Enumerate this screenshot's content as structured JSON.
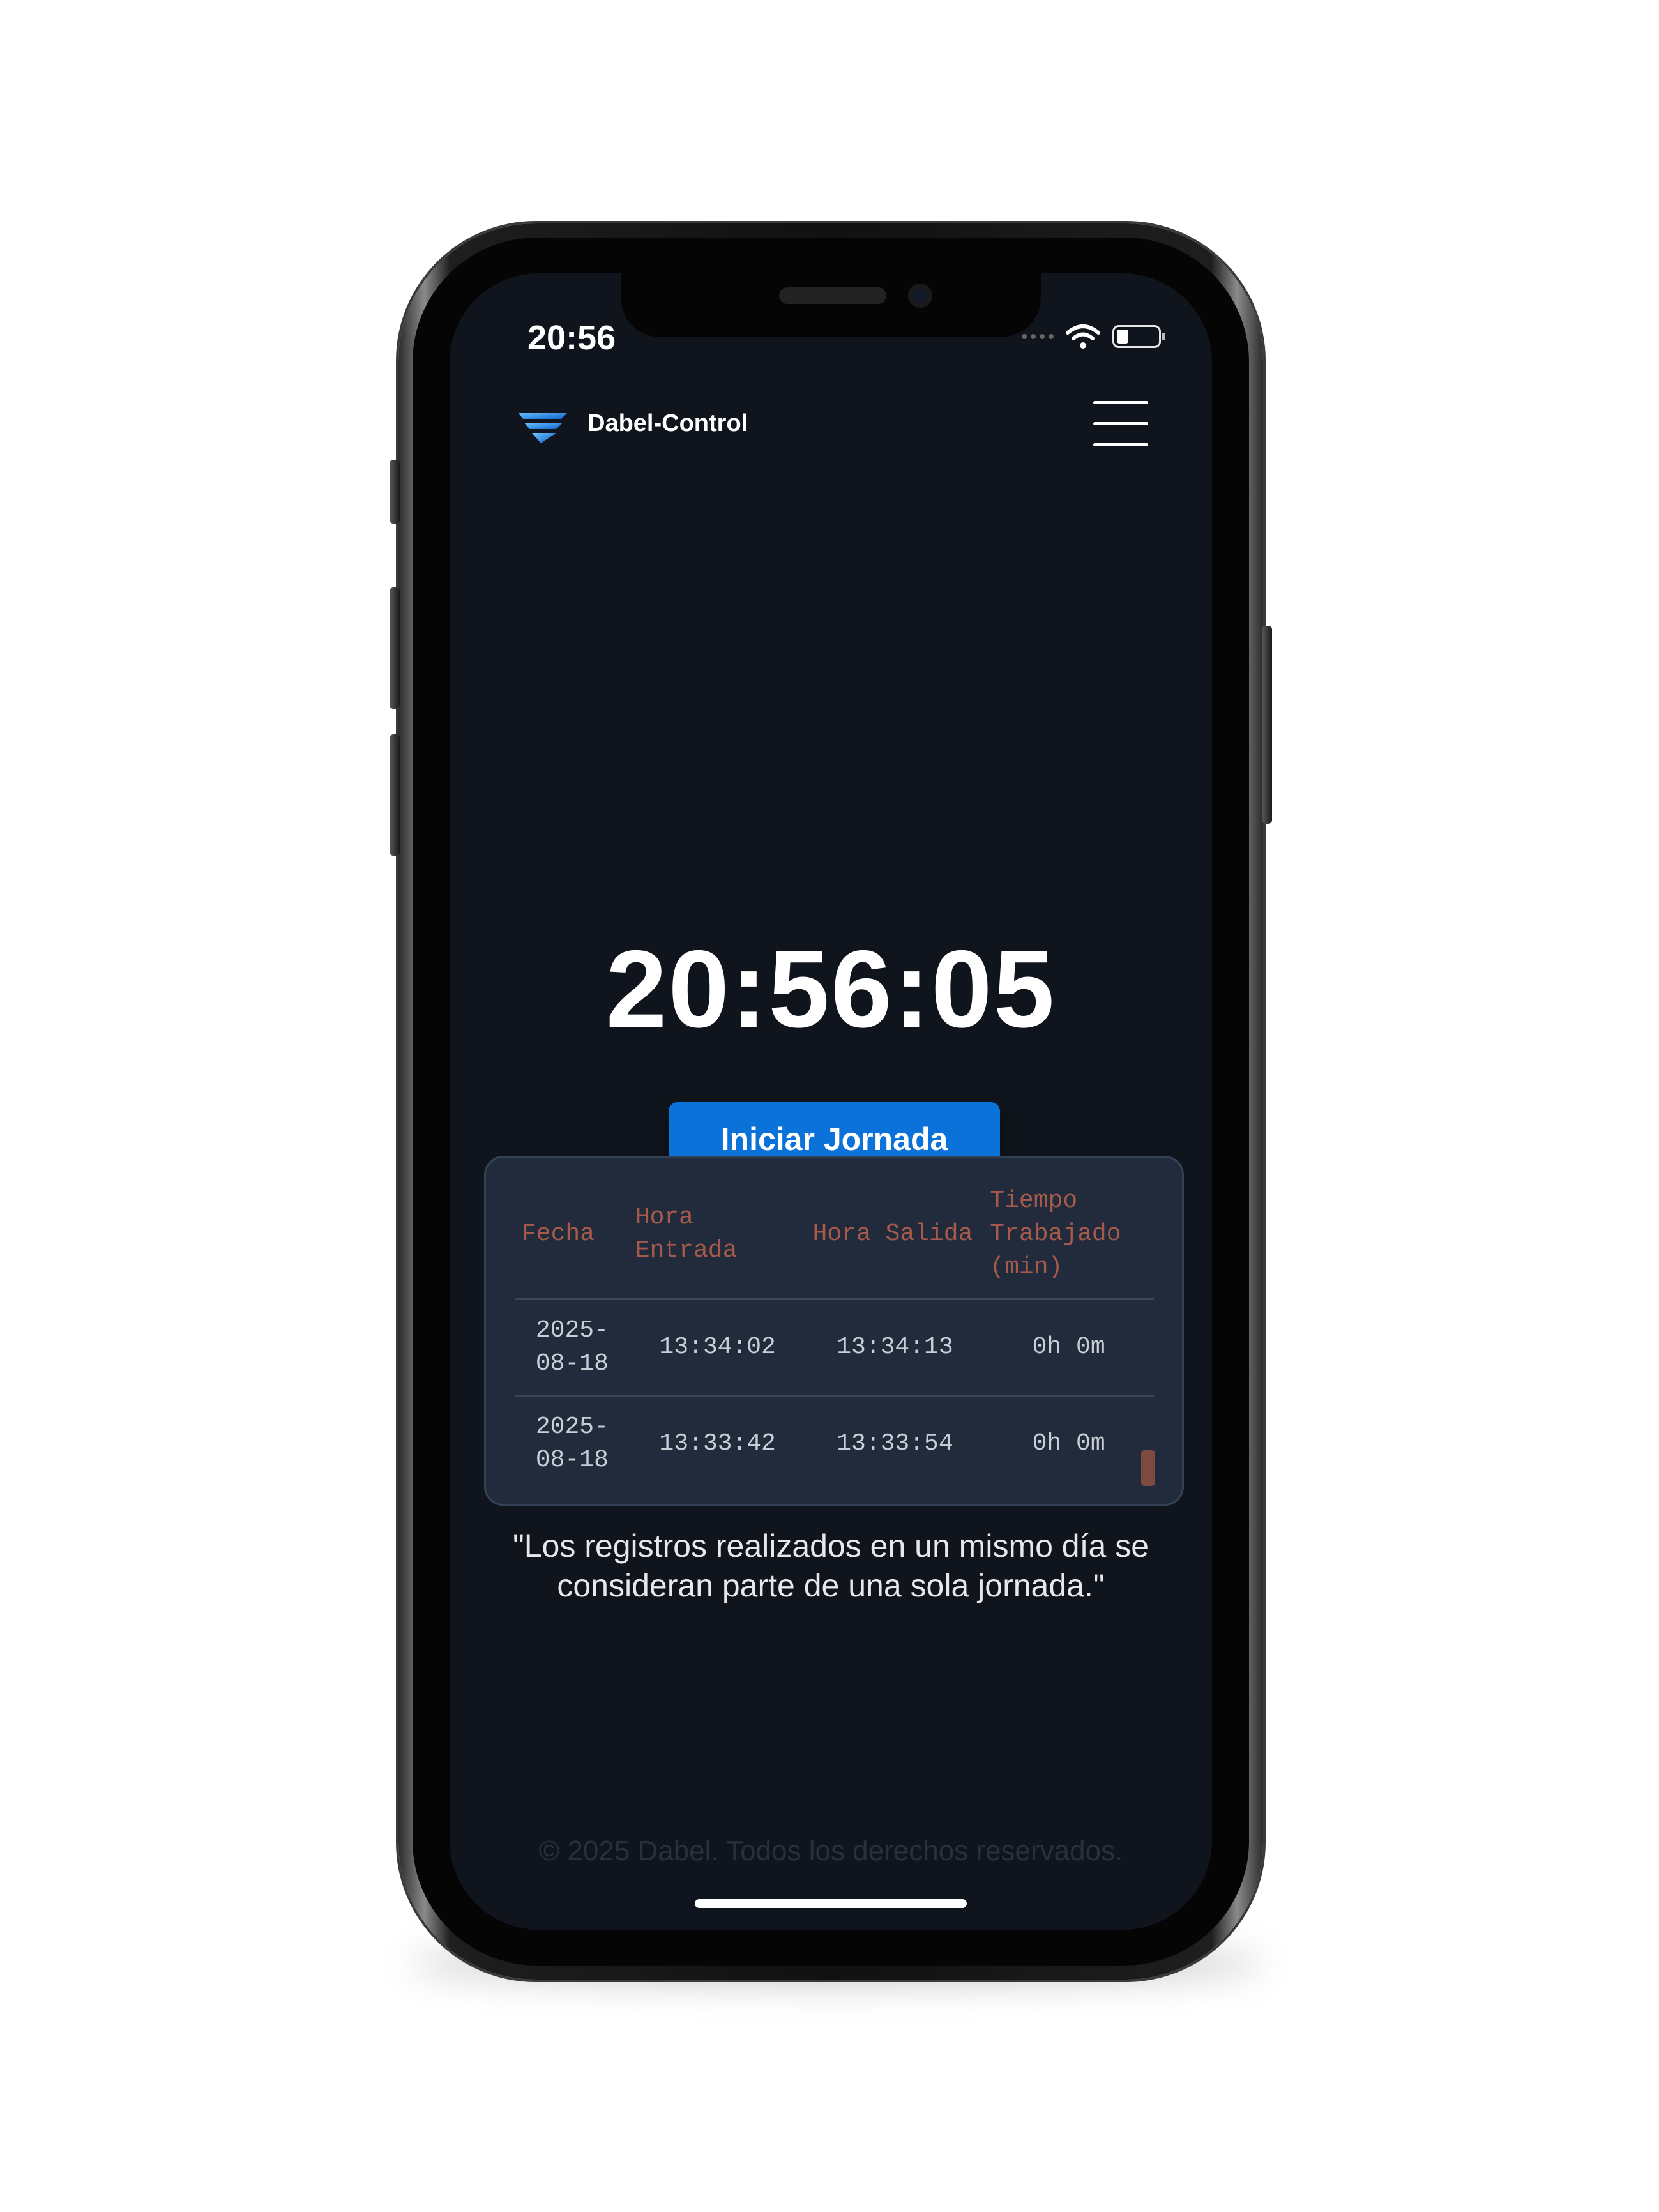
{
  "status_bar": {
    "time": "20:56"
  },
  "navbar": {
    "brand": "Dabel-Control"
  },
  "clock": "20:56:05",
  "actions": {
    "start_label": "Iniciar Jornada"
  },
  "table": {
    "headers": [
      "Fecha",
      "Hora Entrada",
      "Hora Salida",
      "Tiempo Trabajado (min)"
    ],
    "rows": [
      [
        "2025-08-18",
        "13:34:02",
        "13:34:13",
        "0h 0m"
      ],
      [
        "2025-08-18",
        "13:33:42",
        "13:33:54",
        "0h 0m"
      ]
    ]
  },
  "note": "\"Los registros realizados en un mismo día se consideran parte de una sola jornada.\"",
  "footer": "© 2025 Dabel. Todos los derechos reservados.",
  "colors": {
    "background": "#10151d",
    "accent": "#0b72d9",
    "table_header": "#a65a4c",
    "card": "#212b3c"
  },
  "icons": {
    "logo": "dabel-wing-logo",
    "menu": "hamburger-menu-icon"
  }
}
